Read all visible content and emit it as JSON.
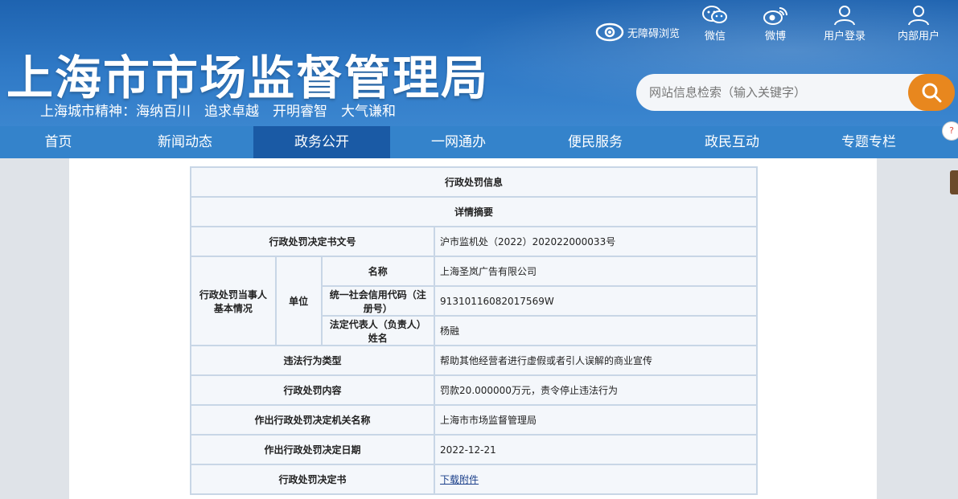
{
  "header": {
    "title": "上海市市场监督管理局",
    "spirit": "上海城市精神：海纳百川　追求卓越　开明睿智　大气谦和",
    "accessibility": "无障碍浏览",
    "icons": [
      {
        "name": "wechat-icon",
        "label": "微信"
      },
      {
        "name": "weibo-icon",
        "label": "微博"
      },
      {
        "name": "user-login-icon",
        "label": "用户登录"
      },
      {
        "name": "internal-user-icon",
        "label": "内部用户"
      }
    ],
    "search": {
      "placeholder": "网站信息检索（输入关键字）"
    }
  },
  "nav": {
    "items": [
      "首页",
      "新闻动态",
      "政务公开",
      "一网通办",
      "便民服务",
      "政民互动",
      "专题专栏"
    ],
    "active": "政务公开"
  },
  "table": {
    "title": "行政处罚信息",
    "subtitle": "详情摘要",
    "doc_no_label": "行政处罚决定书文号",
    "doc_no": "沪市监机处（2022）202022000033号",
    "party_label": "行政处罚当事人基本情况",
    "unit_label": "单位",
    "name_label": "名称",
    "name": "上海圣岚广告有限公司",
    "credit_label": "统一社会信用代码（注册号）",
    "credit": "91310116082017569W",
    "legal_label": "法定代表人（负责人）姓名",
    "legal": "杨融",
    "violation_label": "违法行为类型",
    "violation": "帮助其他经营者进行虚假或者引人误解的商业宣传",
    "penalty_label": "行政处罚内容",
    "penalty": "罚款20.000000万元，责令停止违法行为",
    "authority_label": "作出行政处罚决定机关名称",
    "authority": "上海市市场监督管理局",
    "date_label": "作出行政处罚决定日期",
    "date": "2022-12-21",
    "decision_label": "行政处罚决定书",
    "decision_link": "下载附件"
  }
}
